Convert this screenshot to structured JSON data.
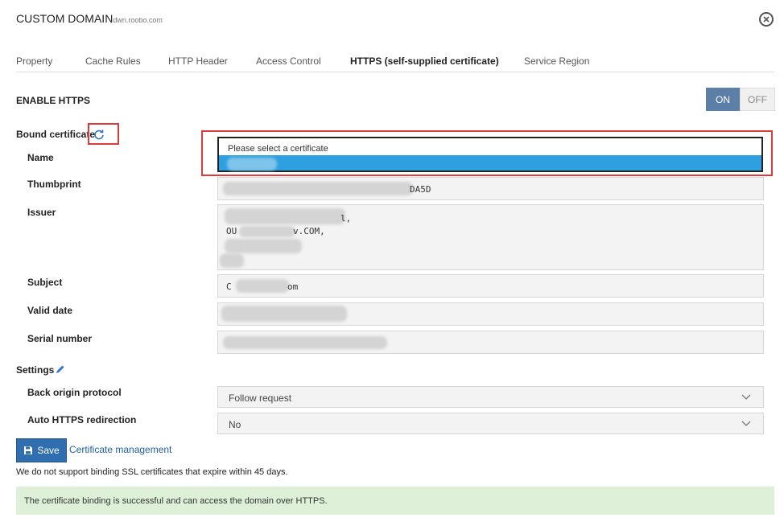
{
  "header": {
    "title": "CUSTOM DOMAIN",
    "domain": "dwn.roobo.com"
  },
  "tabs": [
    {
      "label": "Property"
    },
    {
      "label": "Cache Rules"
    },
    {
      "label": "HTTP Header"
    },
    {
      "label": "Access Control"
    },
    {
      "label": "HTTPS (self-supplied certificate)",
      "active": true
    },
    {
      "label": "Service Region"
    }
  ],
  "https": {
    "enable_label": "ENABLE HTTPS",
    "toggle_on": "ON",
    "toggle_off": "OFF",
    "state": "ON",
    "on_color": "#5b7fa6"
  },
  "certificate": {
    "bound_label": "Bound certificate",
    "refresh_icon": "refresh-icon",
    "select_placeholder": "Please select a certificate",
    "highlight_color": "#2ea0e0",
    "fields": {
      "name_label": "Name",
      "thumbprint_label": "Thumbprint",
      "thumbprint_visible": "DA5D",
      "issuer_label": "Issuer",
      "issuer_visible_line1": "l,",
      "issuer_visible_line2_start": "OU",
      "issuer_visible_line2_end": "v.COM,",
      "subject_label": "Subject",
      "subject_visible_start": "C",
      "subject_visible_end": "om",
      "valid_date_label": "Valid date",
      "serial_label": "Serial number"
    }
  },
  "settings": {
    "label": "Settings",
    "edit_icon": "pencil-icon",
    "back_origin_label": "Back origin protocol",
    "back_origin_value": "Follow request",
    "redirect_label": "Auto HTTPS redirection",
    "redirect_value": "No"
  },
  "actions": {
    "save_label": "Save",
    "cert_management_label": "Certificate management"
  },
  "messages": {
    "note": "We do not support binding SSL certificates that expire within 45 days.",
    "success": "The certificate binding is successful and can access the domain over HTTPS.",
    "success_bg": "#def0d8"
  },
  "annotation_color": "#e03b3b"
}
